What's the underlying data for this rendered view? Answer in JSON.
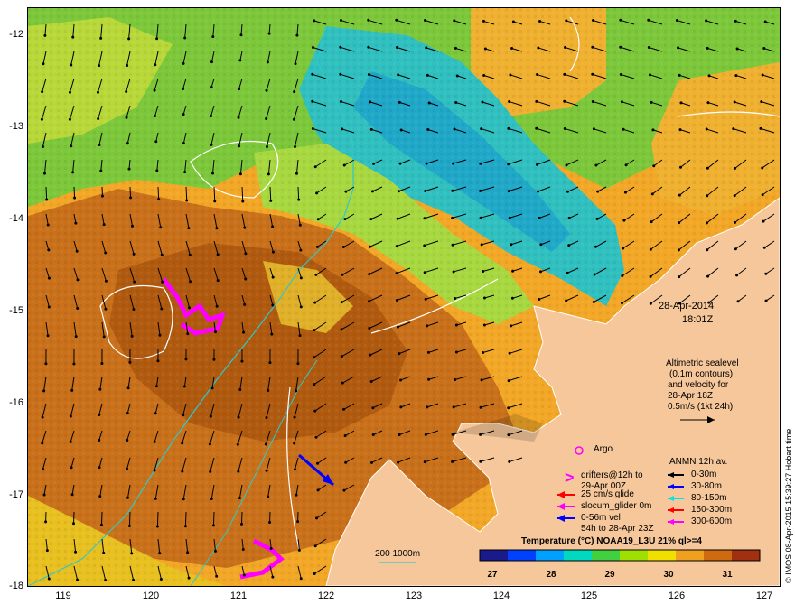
{
  "header": {
    "date": "28-Apr-2014",
    "time": "18:01Z"
  },
  "altimetry_note": {
    "lines": [
      "Altimetric sealevel",
      "(0.1m contours)",
      "and velocity for",
      "28-Apr 18Z",
      "0.5m/s (1kt 24h)"
    ]
  },
  "axes": {
    "lat_labels": [
      "-12",
      "-13",
      "-14",
      "-15",
      "-16",
      "-17",
      "-18"
    ],
    "lon_labels": [
      "119",
      "120",
      "121",
      "122",
      "123",
      "124",
      "125",
      "126",
      "127"
    ]
  },
  "legend_left": {
    "argo": "Argo",
    "drifters": "drifters@12h to",
    "drifters2": "29-Apr 00Z",
    "glide": "25 cm/s glide",
    "glider": "slocum_glider 0m",
    "vel1": "0-56m vel",
    "vel2": "54h to 28-Apr 23Z",
    "drifter_symbol": ">"
  },
  "legend_right": {
    "title": "ANMN 12h av.",
    "items": [
      {
        "label": "0-30m",
        "color": "#000000"
      },
      {
        "label": "30-80m",
        "color": "#0000ff"
      },
      {
        "label": "80-150m",
        "color": "#00e5e5"
      },
      {
        "label": "150-300m",
        "color": "#ff0000"
      },
      {
        "label": "300-600m",
        "color": "#ff00ff"
      }
    ]
  },
  "legend_left_colors": {
    "argo": "#ff00ff",
    "drifter": "#ff00ff",
    "glide": "#ff0000",
    "glider": "#ff00ff",
    "vel": "#0000ff"
  },
  "isobath": {
    "label": "200  1000m",
    "color": "#30c8c8"
  },
  "colorbar": {
    "title": "Temperature (°C) NOAA19_L3U 21% ql>=4",
    "ticks": [
      "27",
      "28",
      "29",
      "30",
      "31"
    ],
    "colors": [
      "#1a1a8c",
      "#0040ff",
      "#00a0ff",
      "#00d8c0",
      "#40d040",
      "#a0e000",
      "#f0e000",
      "#f0a020",
      "#d06a10",
      "#a03010"
    ]
  },
  "credit": "© IMOS 08-Apr-2015 15:39:27 Hobart time"
}
